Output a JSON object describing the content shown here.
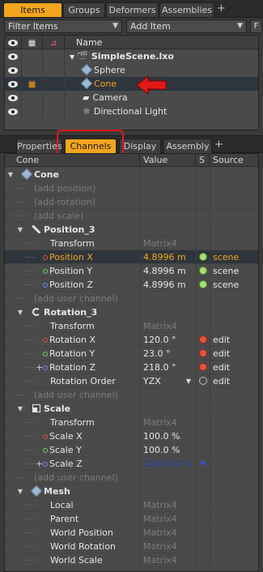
{
  "top_tabs": [
    "Items",
    "Groups",
    "Deformers",
    "Assemblies"
  ],
  "top_tab_active": "Items",
  "add_tab": "+",
  "filter_label": "Filter Items",
  "add_item_label": "Add Item",
  "f_label": "F",
  "items_header": {
    "name": "Name"
  },
  "items": [
    {
      "name": "SimpleScene.lxo",
      "level": 0,
      "expanded": true,
      "visible": true
    },
    {
      "name": "Sphere",
      "level": 1,
      "visible": true
    },
    {
      "name": "Cone",
      "level": 1,
      "visible": true,
      "selected": true
    },
    {
      "name": "Camera",
      "level": 1,
      "visible": true
    },
    {
      "name": "Directional Light",
      "level": 1,
      "visible": true
    }
  ],
  "second_tabs": [
    "Properties",
    "Channels",
    "Display",
    "Assembly"
  ],
  "second_tab_active": "Channels",
  "channel_headers": {
    "name": "Cone",
    "value": "Value",
    "s": "S",
    "source": "Source"
  },
  "channels": [
    {
      "label": "Cone",
      "kind": "item",
      "icon": "cube"
    },
    {
      "label": "(add position)",
      "kind": "add"
    },
    {
      "label": "(add rotation)",
      "kind": "add"
    },
    {
      "label": "(add scale)",
      "kind": "add"
    },
    {
      "label": "Position_3",
      "kind": "group",
      "icon": "pos"
    },
    {
      "label": "Transform",
      "value": "Matrix4",
      "value_dim": true
    },
    {
      "label": "Position X",
      "value": "4.8996 m",
      "dot": "green",
      "source": "scene",
      "pin": "r",
      "selected": true
    },
    {
      "label": "Position Y",
      "value": "4.8996 m",
      "dot": "green",
      "source": "scene",
      "pin": "g"
    },
    {
      "label": "Position Z",
      "value": "4.8996 m",
      "dot": "green",
      "source": "scene",
      "pin": "b"
    },
    {
      "label": "(add user channel)",
      "kind": "add"
    },
    {
      "label": "Rotation_3",
      "kind": "group",
      "icon": "rot"
    },
    {
      "label": "Transform",
      "value": "Matrix4",
      "value_dim": true
    },
    {
      "label": "Rotation X",
      "value": "120.0 °",
      "dot": "red",
      "source": "edit",
      "pin": "r"
    },
    {
      "label": "Rotation Y",
      "value": "23.0 °",
      "dot": "red",
      "source": "edit",
      "pin": "g"
    },
    {
      "label": "Rotation Z",
      "value": "218.0 °",
      "dot": "red",
      "source": "edit",
      "pin": "b",
      "plus": true
    },
    {
      "label": "Rotation Order",
      "value": "YZX",
      "dot": "empty",
      "source": "edit",
      "dropdown": true
    },
    {
      "label": "(add user channel)",
      "kind": "add"
    },
    {
      "label": "Scale",
      "kind": "group",
      "icon": "scale"
    },
    {
      "label": "Transform",
      "value": "Matrix4",
      "value_dim": true
    },
    {
      "label": "Scale X",
      "value": "100.0 %",
      "pin": "r"
    },
    {
      "label": "Scale Y",
      "value": "100.0 %",
      "pin": "g"
    },
    {
      "label": "Scale Z",
      "value": "21800.0 %",
      "value_blue": true,
      "gear": true,
      "pin": "b",
      "plus": true
    },
    {
      "label": "(add user channel)",
      "kind": "add"
    },
    {
      "label": "Mesh",
      "kind": "group",
      "icon": "cube"
    },
    {
      "label": "Local",
      "value": "Matrix4",
      "value_dim": true
    },
    {
      "label": "Parent",
      "value": "Matrix4",
      "value_dim": true
    },
    {
      "label": "World Position",
      "value": "Matrix4",
      "value_dim": true
    },
    {
      "label": "World Rotation",
      "value": "Matrix4",
      "value_dim": true
    },
    {
      "label": "World Scale",
      "value": "Matrix4",
      "value_dim": true
    }
  ]
}
